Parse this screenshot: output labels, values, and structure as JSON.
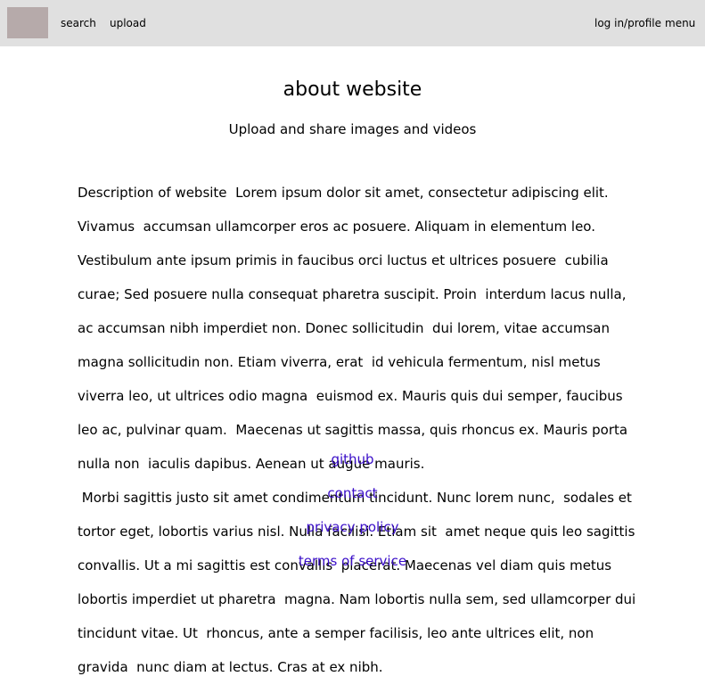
{
  "header": {
    "logo_label": "",
    "search_label": "search",
    "upload_label": "upload",
    "login_label": "log in/profile",
    "menu_label": "menu"
  },
  "main": {
    "title": "about website",
    "subtitle": "Upload and share images and videos",
    "description_lines": [
      "Description of website  Lorem ipsum dolor sit amet, consectetur adipiscing elit.",
      "Vivamus  accumsan ullamcorper eros ac posuere. Aliquam in elementum leo.",
      "Vestibulum ante ipsum primis in faucibus orci luctus et ultrices posuere  cubilia",
      "curae; Sed posuere nulla consequat pharetra suscipit. Proin  interdum lacus nulla,",
      "ac accumsan nibh imperdiet non. Donec sollicitudin  dui lorem, vitae accumsan",
      "magna sollicitudin non. Etiam viverra, erat  id vehicula fermentum, nisl metus",
      "viverra leo, ut ultrices odio magna  euismod ex. Mauris quis dui semper, faucibus",
      "leo ac, pulvinar quam.  Maecenas ut sagittis massa, quis rhoncus ex. Mauris porta",
      "nulla non  iaculis dapibus. Aenean ut augue mauris.",
      " Morbi sagittis justo sit amet condimentum tincidunt. Nunc lorem nunc,  sodales et",
      "tortor eget, lobortis varius nisl. Nulla facilisi. Etiam sit  amet neque quis leo sagittis",
      "convallis. Ut a mi sagittis est convallis  placerat. Maecenas vel diam quis metus",
      "lobortis imperdiet ut pharetra  magna. Nam lobortis nulla sem, sed ullamcorper dui",
      "tincidunt vitae. Ut  rhoncus, ante a semper facilisis, leo ante ultrices elit, non",
      "gravida  nunc diam at lectus. Cras at ex nibh."
    ]
  },
  "footer": {
    "github": "github",
    "contact": "contact",
    "privacy": "privacy policy",
    "terms": "terms of service"
  },
  "colors": {
    "topbar_bg": "#e0e0e0",
    "logo_placeholder": "#b6aaaa",
    "link": "#3a0ec8"
  }
}
